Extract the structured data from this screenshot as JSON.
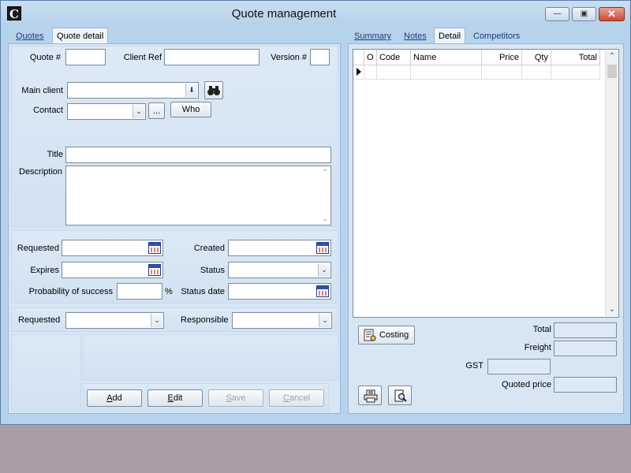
{
  "window": {
    "title": "Quote management",
    "app_icon_letter": "C"
  },
  "left_tabs": [
    {
      "label": "Quotes",
      "active": false
    },
    {
      "label": "Quote detail",
      "active": true
    }
  ],
  "right_tabs": [
    {
      "label": "Summary",
      "active": false
    },
    {
      "label": "Notes",
      "active": false
    },
    {
      "label": "Detail",
      "active": true
    },
    {
      "label": "Competitors",
      "active": false
    }
  ],
  "quote_header": {
    "quote_no_label": "Quote #",
    "quote_no_value": "",
    "client_ref_label": "Client Ref",
    "client_ref_value": "",
    "version_label": "Version #",
    "version_value": ""
  },
  "client": {
    "main_client_label": "Main client",
    "main_client_value": "",
    "contact_label": "Contact",
    "contact_value": "",
    "ellipsis_label": "...",
    "who_label": "Who"
  },
  "description_block": {
    "title_label": "Title",
    "title_value": "",
    "description_label": "Description",
    "description_value": ""
  },
  "dates": {
    "requested_label": "Requested",
    "requested_value": "",
    "created_label": "Created",
    "created_value": "",
    "expires_label": "Expires",
    "expires_value": "",
    "status_label": "Status",
    "status_value": "",
    "probability_label": "Probability of success",
    "probability_value": "",
    "percent_sign": "%",
    "status_date_label": "Status date",
    "status_date_value": ""
  },
  "assignment": {
    "requested_label": "Requested",
    "requested_value": "",
    "responsible_label": "Responsible",
    "responsible_value": ""
  },
  "actions": {
    "add": {
      "pre": "",
      "key": "A",
      "post": "dd"
    },
    "edit": {
      "pre": "",
      "key": "E",
      "post": "dit"
    },
    "save": {
      "pre": "",
      "key": "S",
      "post": "ave"
    },
    "cancel": {
      "pre": "",
      "key": "C",
      "post": "ancel"
    }
  },
  "detail_grid": {
    "columns": [
      "O",
      "Code",
      "Name",
      "Price",
      "Qty",
      "Total"
    ],
    "rows": [
      [
        "",
        "",
        "",
        "",
        "",
        ""
      ]
    ]
  },
  "totals": {
    "costing_label": "Costing",
    "total_label": "Total",
    "total_value": "",
    "freight_label": "Freight",
    "freight_value": "",
    "gst_label": "GST",
    "gst_value": "",
    "quoted_price_label": "Quoted price",
    "quoted_price_value": ""
  },
  "icons": {
    "binoculars": "binoculars-icon",
    "calendar": "calendar-icon",
    "print": "print-icon",
    "preview": "print-preview-icon",
    "costing": "costing-icon"
  }
}
